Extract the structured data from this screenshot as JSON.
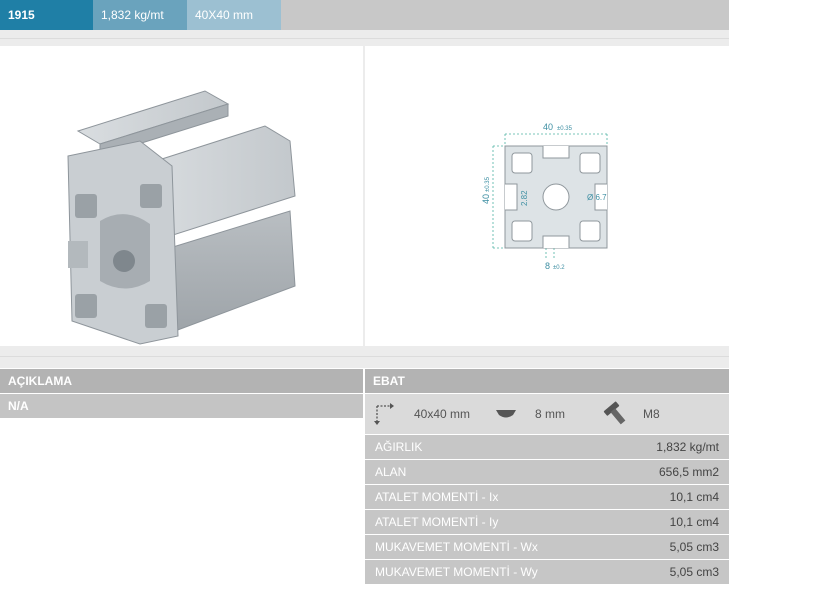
{
  "header": {
    "code": "1915",
    "weight": "1,832 kg/mt",
    "size": "40X40 mm"
  },
  "drawing": {
    "width": "40",
    "width_tol": "±0.35",
    "height": "40",
    "height_tol": "±0.35",
    "inner": "2.82",
    "hole": "Ø 6.7",
    "slot": "8",
    "slot_tol": "±0.2"
  },
  "description": {
    "label": "AÇIKLAMA",
    "value": "N/A"
  },
  "ebat": {
    "label": "EBAT",
    "dimension": "40x40 mm",
    "slot": "8 mm",
    "bolt": "M8"
  },
  "properties": [
    {
      "label": "AĞIRLIK",
      "value": "1,832 kg/mt"
    },
    {
      "label": "ALAN",
      "value": "656,5 mm2"
    },
    {
      "label": "ATALET MOMENTİ - Ix",
      "value": "10,1 cm4"
    },
    {
      "label": "ATALET MOMENTİ - Iy",
      "value": "10,1 cm4"
    },
    {
      "label": "MUKAVEMET MOMENTİ - Wx",
      "value": "5,05 cm3"
    },
    {
      "label": "MUKAVEMET MOMENTİ - Wy",
      "value": "5,05 cm3"
    }
  ]
}
